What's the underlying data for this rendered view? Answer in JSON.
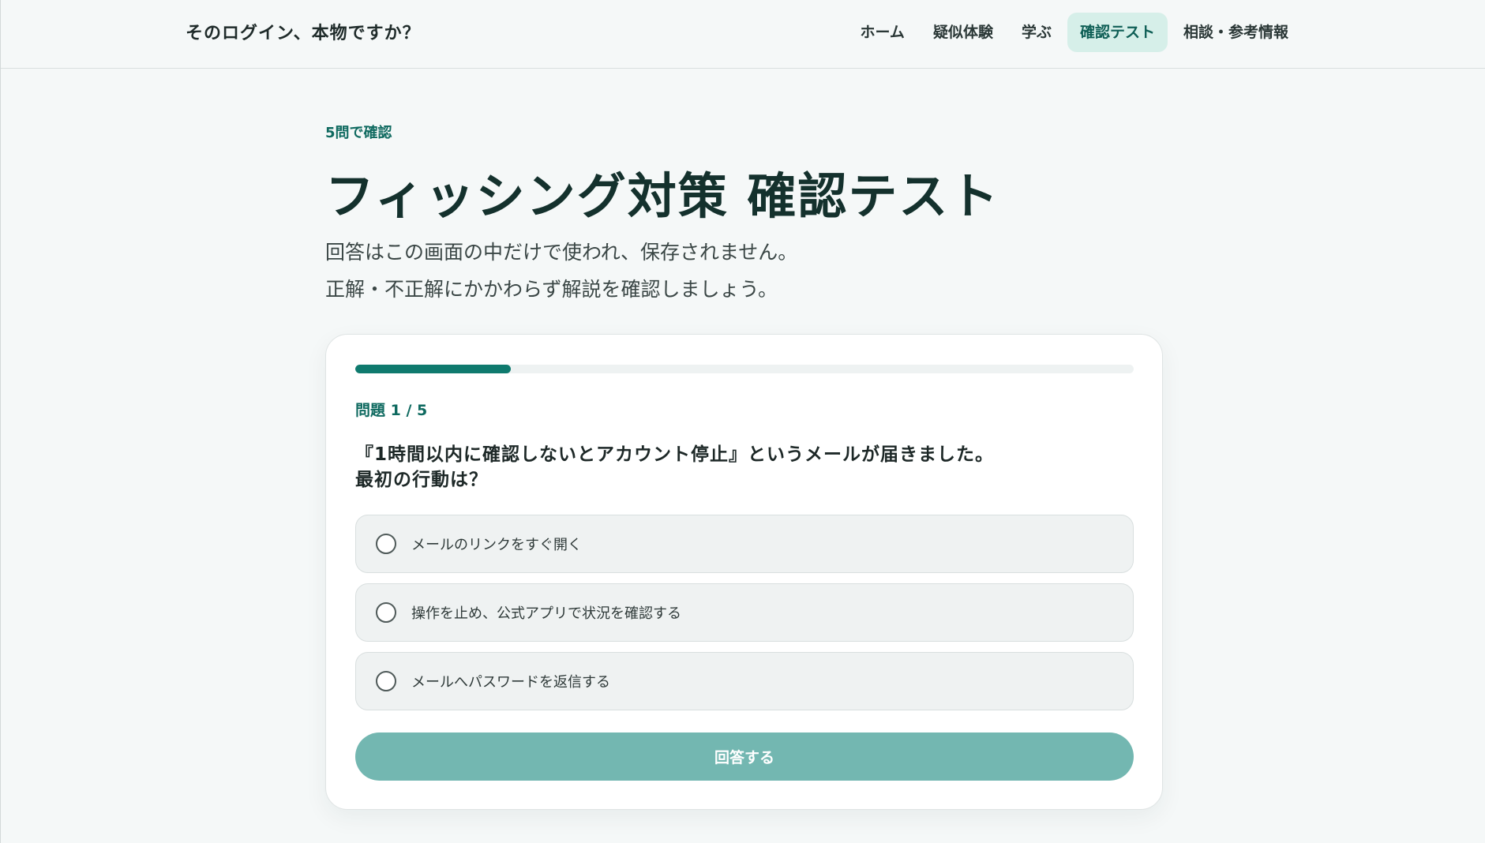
{
  "header": {
    "brand": "そのログイン、本物ですか？",
    "nav": [
      {
        "label": "ホーム",
        "active": false
      },
      {
        "label": "疑似体験",
        "active": false
      },
      {
        "label": "学ぶ",
        "active": false
      },
      {
        "label": "確認テスト",
        "active": true
      },
      {
        "label": "相談・参考情報",
        "active": false
      }
    ]
  },
  "intro": {
    "eyebrow": "5問で確認",
    "title": "フィッシング対策 確認テスト",
    "desc_line1": "回答はこの画面の中だけで使われ、保存されません。",
    "desc_line2": "正解・不正解にかかわらず解説を確認しましょう。"
  },
  "quiz": {
    "progress_fraction": 0.2,
    "counter": "問題 1 / 5",
    "question_line1": "『1時間以内に確認しないとアカウント停止』というメールが届きました。",
    "question_line2": "最初の行動は？",
    "options": [
      {
        "label": "メールのリンクをすぐ開く"
      },
      {
        "label": "操作を止め、公式アプリで状況を確認する"
      },
      {
        "label": "メールへパスワードを返信する"
      }
    ],
    "submit_label": "回答する"
  },
  "colors": {
    "accent": "#0f7a6e",
    "accent_light": "#d6efe9",
    "button_disabled": "#73b7b1"
  }
}
